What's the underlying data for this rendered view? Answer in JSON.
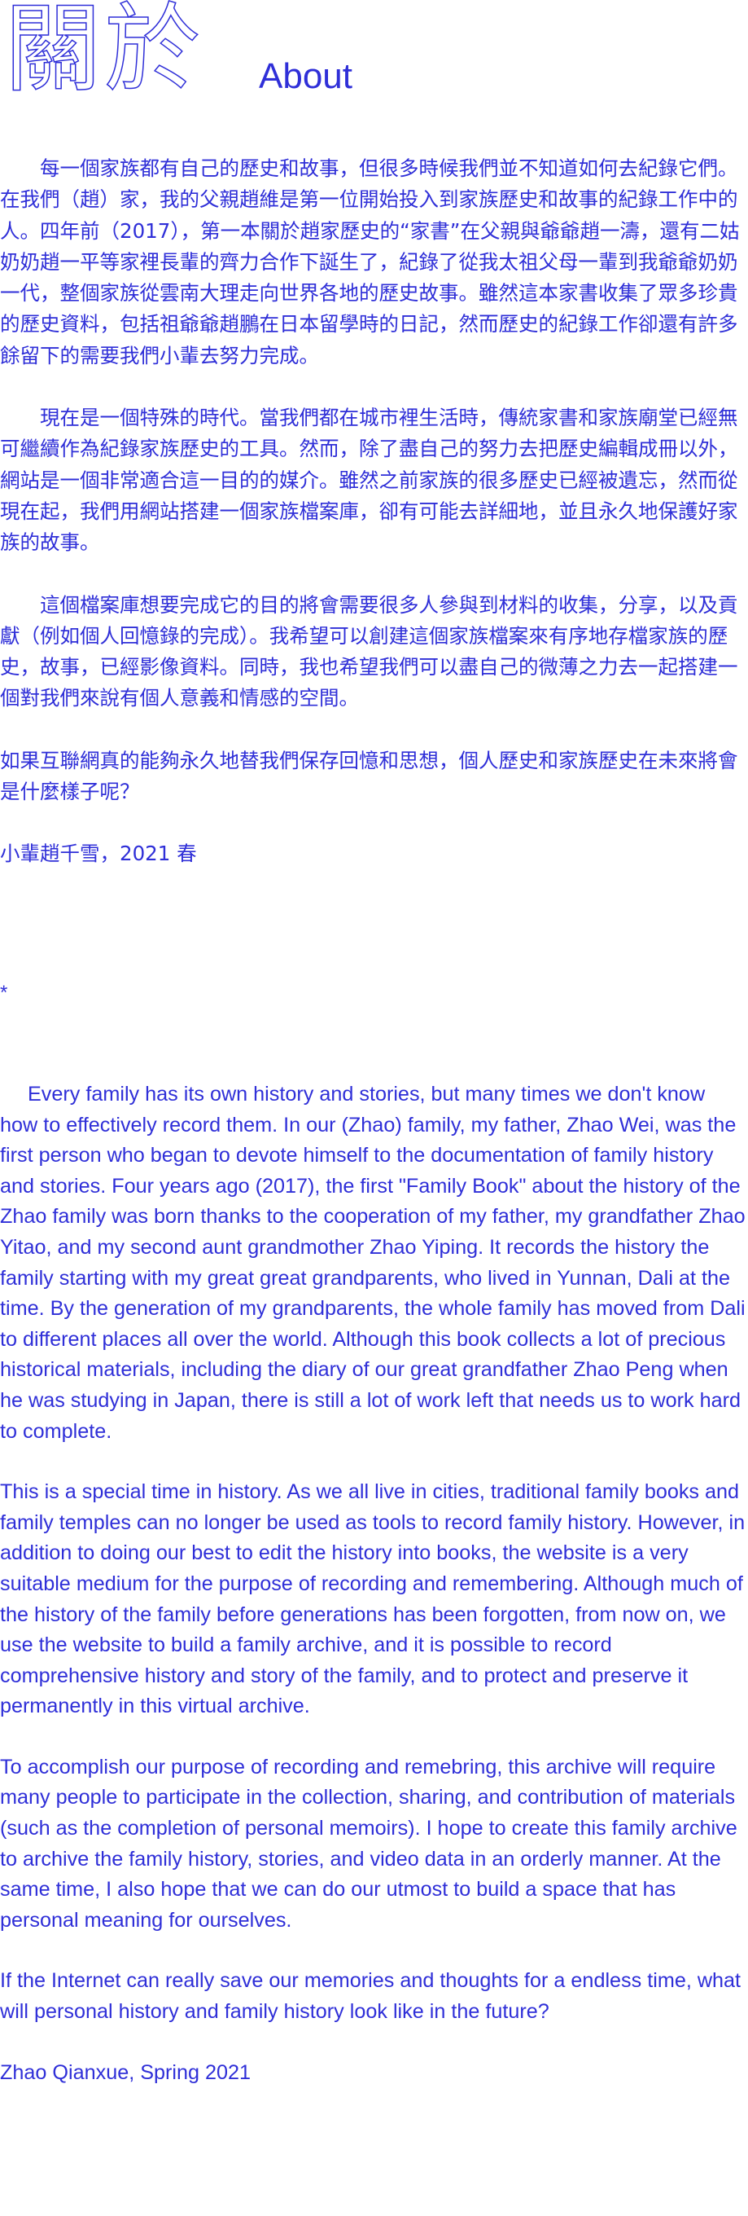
{
  "header": {
    "title_zh": "關於",
    "title_en": "About"
  },
  "zh": {
    "paragraphs": [
      "每一個家族都有自己的歷史和故事，但很多時候我們並不知道如何去紀錄它們。在我們（趙）家，我的父親趙維是第一位開始投入到家族歷史和故事的紀錄工作中的人。四年前（2017），第一本關於趙家歷史的“家書”在父親與爺爺趙一濤，還有二姑奶奶趙一平等家裡長輩的齊力合作下誕生了，紀錄了從我太祖父母一輩到我爺爺奶奶一代，整個家族從雲南大理走向世界各地的歷史故事。雖然這本家書收集了眾多珍貴的歷史資料，包括祖爺爺趙鵬在日本留學時的日記，然而歷史的紀錄工作卻還有許多餘留下的需要我們小輩去努力完成。",
      "現在是一個特殊的時代。當我們都在城市裡生活時，傳統家書和家族廟堂已經無可繼續作為紀錄家族歷史的工具。然而，除了盡自己的努力去把歷史編輯成冊以外，網站是一個非常適合這一目的的媒介。雖然之前家族的很多歷史已經被遺忘，然而從現在起，我們用網站搭建一個家族檔案庫，卻有可能去詳細地，並且永久地保護好家族的故事。",
      "這個檔案庫想要完成它的目的將會需要很多人參與到材料的收集，分享，以及貢獻（例如個人回憶錄的完成）。我希望可以創建這個家族檔案來有序地存檔家族的歷史，故事，已經影像資料。同時，我也希望我們可以盡自己的微薄之力去一起搭建一個對我們來說有個人意義和情感的空間。",
      "如果互聯網真的能夠永久地替我們保存回憶和思想，個人歷史和家族歷史在未來將會是什麼樣子呢？"
    ],
    "signature": "小輩趙千雪，2021 春"
  },
  "separator": "*",
  "en": {
    "paragraphs": [
      "Every family has its own history and stories, but many times we don't know how to effectively record them. In our (Zhao) family, my father, Zhao Wei, was the first person who began to devote himself to the documen­tation of family history and stories. Four years ago (2017), the first \"Family Book\" about the history of the Zhao family was born thanks to the cooperation of my father, my grandfather Zhao Yitao, and my second aunt grandmother Zhao Yiping. It records the history the family starting with my great great grandparents, who lived in Yunnan, Dali at the time. By the generation of my grandparents, the whole family has moved from Dali to different places all over the world. Although this book collects a lot of precious historical materials, including the diary of our great grand­father Zhao Peng when he was studying in Japan, there is still a lot of work left that needs us to work hard to complete.",
      "This is a special time in history. As we all live in cities, traditional family books and family temples can no longer be used as tools to record family history. However, in addition to doing our best to edit the history into books, the website is a very suitable medium for the purpose of record­ing and remembering. Although much of the history of the family before generations has been forgotten, from now on, we use the website to build a family archive, and it is possible to record comprehensive history and story of the family, and to protect and preserve it permanently in this virtual archive.",
      "To accomplish our purpose of recording and remebring, this archive will require many people to participate in the collection, sharing, and contri­bution of materials (such as the completion of personal memoirs). I hope to create this family archive to archive the family history, stories, and video data in an orderly manner. At the same time, I also hope that we can do our utmost to build a space that has personal meaning for our­selves.",
      "If the Internet can really save our memories and thoughts for a endless time, what will personal history and family history look like in the future?"
    ],
    "signature": "Zhao Qianxue, Spring 2021"
  },
  "colors": {
    "text": "#2f2fd8",
    "background": "#ffffff"
  }
}
